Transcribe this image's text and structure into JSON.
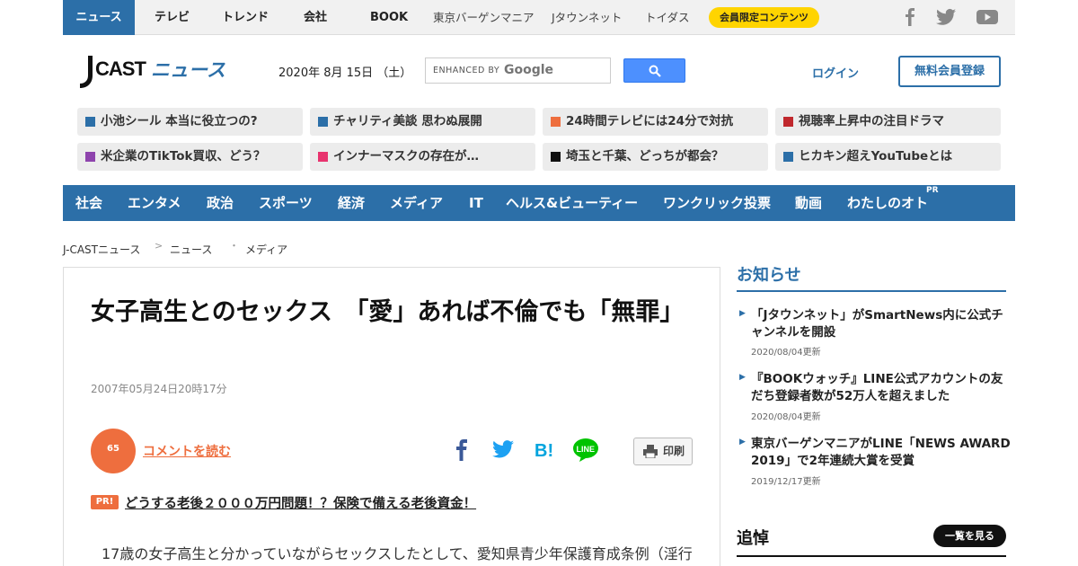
{
  "top_nav": {
    "tabs": [
      "ニュース",
      "テレビ",
      "トレンド",
      "会社",
      "BOOK"
    ],
    "sub_links": [
      "東京バーゲンマニア",
      "Jタウンネット",
      "トイダス"
    ],
    "member_pill": "会員限定コンテンツ",
    "social_icons": [
      "facebook-icon",
      "twitter-icon",
      "youtube-icon"
    ]
  },
  "header": {
    "logo_text": "J-CAST ニュース",
    "date": "2020年 8月 15日 （土）",
    "search_enhanced": "ENHANCED BY",
    "search_google": "Google",
    "login": "ログイン",
    "register": "無料会員登録"
  },
  "trending": [
    {
      "label": "小池シール 本当に役立つの?",
      "color": "#2c6fa8"
    },
    {
      "label": "チャリティ美談 思わぬ展開",
      "color": "#2c6fa8"
    },
    {
      "label": "24時間テレビには24分で対抗",
      "color": "#ee6e3e"
    },
    {
      "label": "視聴率上昇中の注目ドラマ",
      "color": "#c0282d"
    },
    {
      "label": "米企業のTikTok買収、どう？",
      "color": "#8e44ad"
    },
    {
      "label": "インナーマスクの存在が…",
      "color": "#e8336e"
    },
    {
      "label": "埼玉と千葉、どっちが都会？",
      "color": "#111111"
    },
    {
      "label": "ヒカキン超えYouTubeとは",
      "color": "#2c6fa8"
    }
  ],
  "categories": [
    "社会",
    "エンタメ",
    "政治",
    "スポーツ",
    "経済",
    "メディア",
    "IT",
    "ヘルス&ビューティー",
    "ワンクリック投票",
    "動画",
    "わたしのオト"
  ],
  "categories_pr": "PR",
  "breadcrumb": [
    "J-CASTニュース",
    "ニュース",
    "メディア"
  ],
  "article": {
    "title": "女子高生とのセックス　「愛」あれば不倫でも「無罪」",
    "date": "2007年05月24日20時17分",
    "comment_count": "65",
    "comment_link": "コメントを読む",
    "share_icons": [
      "facebook-share-icon",
      "twitter-share-icon",
      "hatena-bookmark-icon",
      "line-share-icon"
    ],
    "print": "印刷",
    "pr_badge": "PR!",
    "pr_link": "どうする老後２０００万円問題！？保険で備える老後資金！",
    "body": "17歳の女子高生と分かっていながらセックスしたとして、愛知県青少年保護育成条例（淫行"
  },
  "sidebar": {
    "notice_title": "お知らせ",
    "notices": [
      {
        "text": "「Jタウンネット」がSmartNews内に公式チャンネルを開設",
        "date": "2020/08/04更新"
      },
      {
        "text": "『BOOKウォッチ』LINE公式アカウントの友だち登録者数が52万人を超えました",
        "date": "2020/08/04更新"
      },
      {
        "text": "東京バーゲンマニアがLINE「NEWS AWARD 2019」で2年連続大賞を受賞",
        "date": "2019/12/17更新"
      }
    ],
    "tsuito_title": "追悼",
    "see_all": "一覧を見る"
  }
}
